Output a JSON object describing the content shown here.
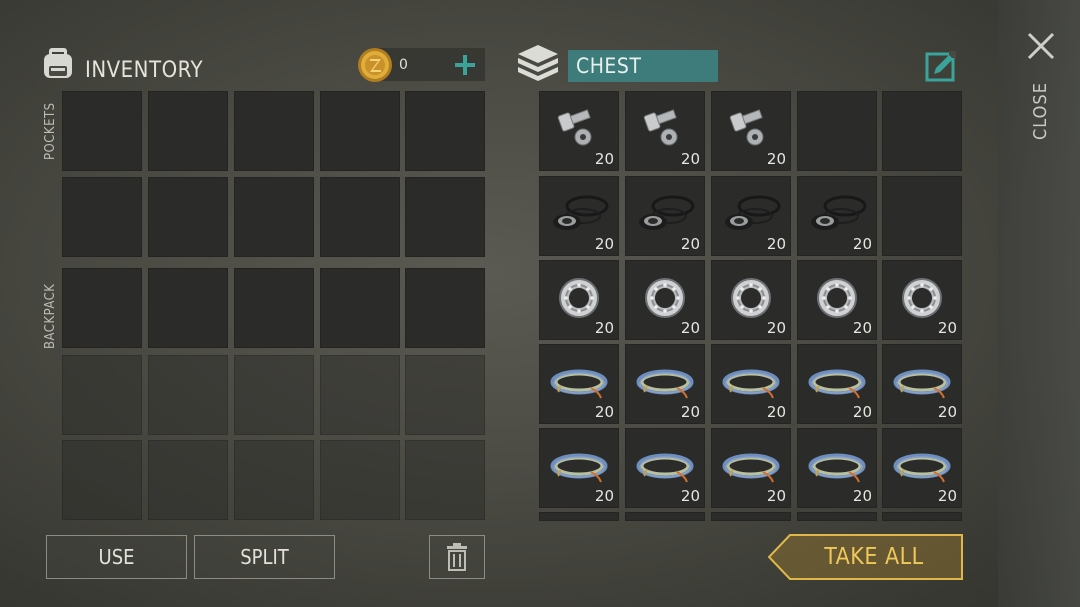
{
  "inventory": {
    "title": "INVENTORY",
    "coins": "0",
    "add_icon": "plus-icon",
    "backpack_icon": "backpack-icon",
    "coin_icon": "z-coin-icon",
    "sections": {
      "pockets": "POCKETS",
      "backpack": "BACKPACK"
    }
  },
  "chest": {
    "title": "CHEST",
    "chest_icon": "chest-icon",
    "edit_icon": "edit-pencil-icon",
    "rows": [
      [
        {
          "item": "bolts-and-nuts",
          "qty": "20"
        },
        {
          "item": "bolts-and-nuts",
          "qty": "20"
        },
        {
          "item": "bolts-and-nuts",
          "qty": "20"
        },
        null,
        null
      ],
      [
        {
          "item": "rubber-seals",
          "qty": "20"
        },
        {
          "item": "rubber-seals",
          "qty": "20"
        },
        {
          "item": "rubber-seals",
          "qty": "20"
        },
        {
          "item": "rubber-seals",
          "qty": "20"
        },
        null
      ],
      [
        {
          "item": "bearing",
          "qty": "20"
        },
        {
          "item": "bearing",
          "qty": "20"
        },
        {
          "item": "bearing",
          "qty": "20"
        },
        {
          "item": "bearing",
          "qty": "20"
        },
        {
          "item": "bearing",
          "qty": "20"
        }
      ],
      [
        {
          "item": "wires",
          "qty": "20"
        },
        {
          "item": "wires",
          "qty": "20"
        },
        {
          "item": "wires",
          "qty": "20"
        },
        {
          "item": "wires",
          "qty": "20"
        },
        {
          "item": "wires",
          "qty": "20"
        }
      ],
      [
        {
          "item": "wires",
          "qty": "20"
        },
        {
          "item": "wires",
          "qty": "20"
        },
        {
          "item": "wires",
          "qty": "20"
        },
        {
          "item": "wires",
          "qty": "20"
        },
        {
          "item": "wires",
          "qty": "20"
        }
      ]
    ]
  },
  "actions": {
    "use": "USE",
    "split": "SPLIT",
    "trash_icon": "trash-icon",
    "take_all": "TAKE ALL",
    "close": "CLOSE",
    "close_icon": "close-x-icon"
  },
  "colors": {
    "accent_teal": "#3aa39a",
    "chest_title_bg": "#3d7c7a",
    "take_all_gold": "#e0b84a",
    "slot_bg": "#2b2c2a"
  }
}
